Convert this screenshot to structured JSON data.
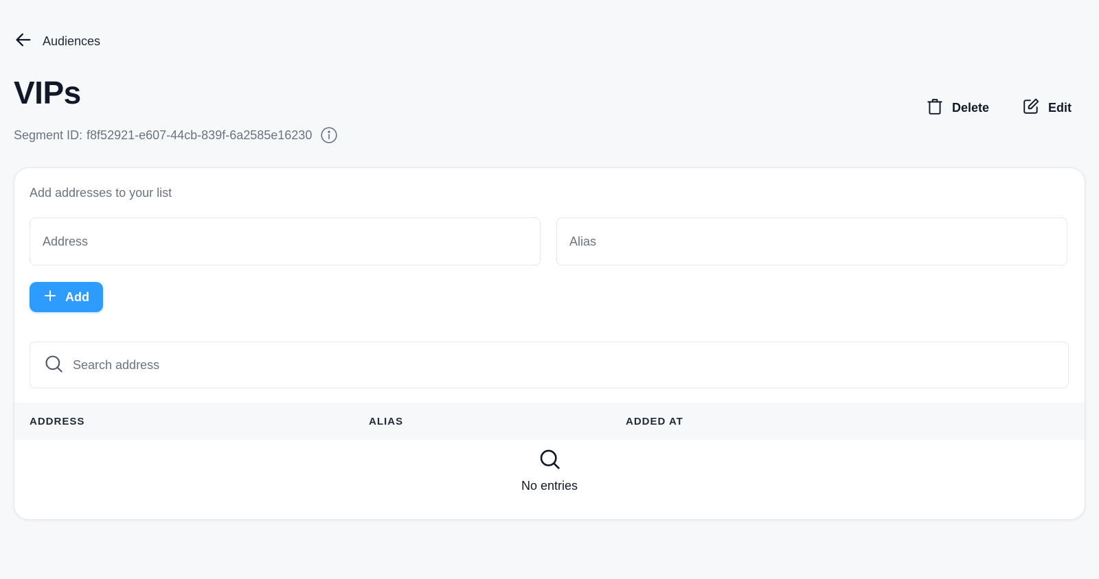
{
  "nav": {
    "back_label": "Audiences",
    "back_icon": "arrow-left-icon"
  },
  "header": {
    "title": "VIPs",
    "segment_id_label": "Segment ID:",
    "segment_id_value": "f8f52921-e607-44cb-839f-6a2585e16230",
    "info_icon": "info-icon",
    "actions": {
      "delete_label": "Delete",
      "delete_icon": "trash-icon",
      "edit_label": "Edit",
      "edit_icon": "edit-icon"
    }
  },
  "add_form": {
    "label": "Add addresses to your list",
    "address_placeholder": "Address",
    "address_value": "",
    "alias_placeholder": "Alias",
    "alias_value": "",
    "add_button_label": "Add",
    "add_icon": "plus-icon"
  },
  "search": {
    "placeholder": "Search address",
    "value": "",
    "icon": "search-icon"
  },
  "table": {
    "columns": [
      "ADDRESS",
      "ALIAS",
      "ADDED AT"
    ],
    "rows": [],
    "empty_text": "No entries",
    "empty_icon": "search-icon"
  },
  "colors": {
    "background": "#f7f8fa",
    "primary": "#2e9bff",
    "text": "#111827",
    "muted": "#6b7280",
    "border": "#e5e7eb"
  }
}
